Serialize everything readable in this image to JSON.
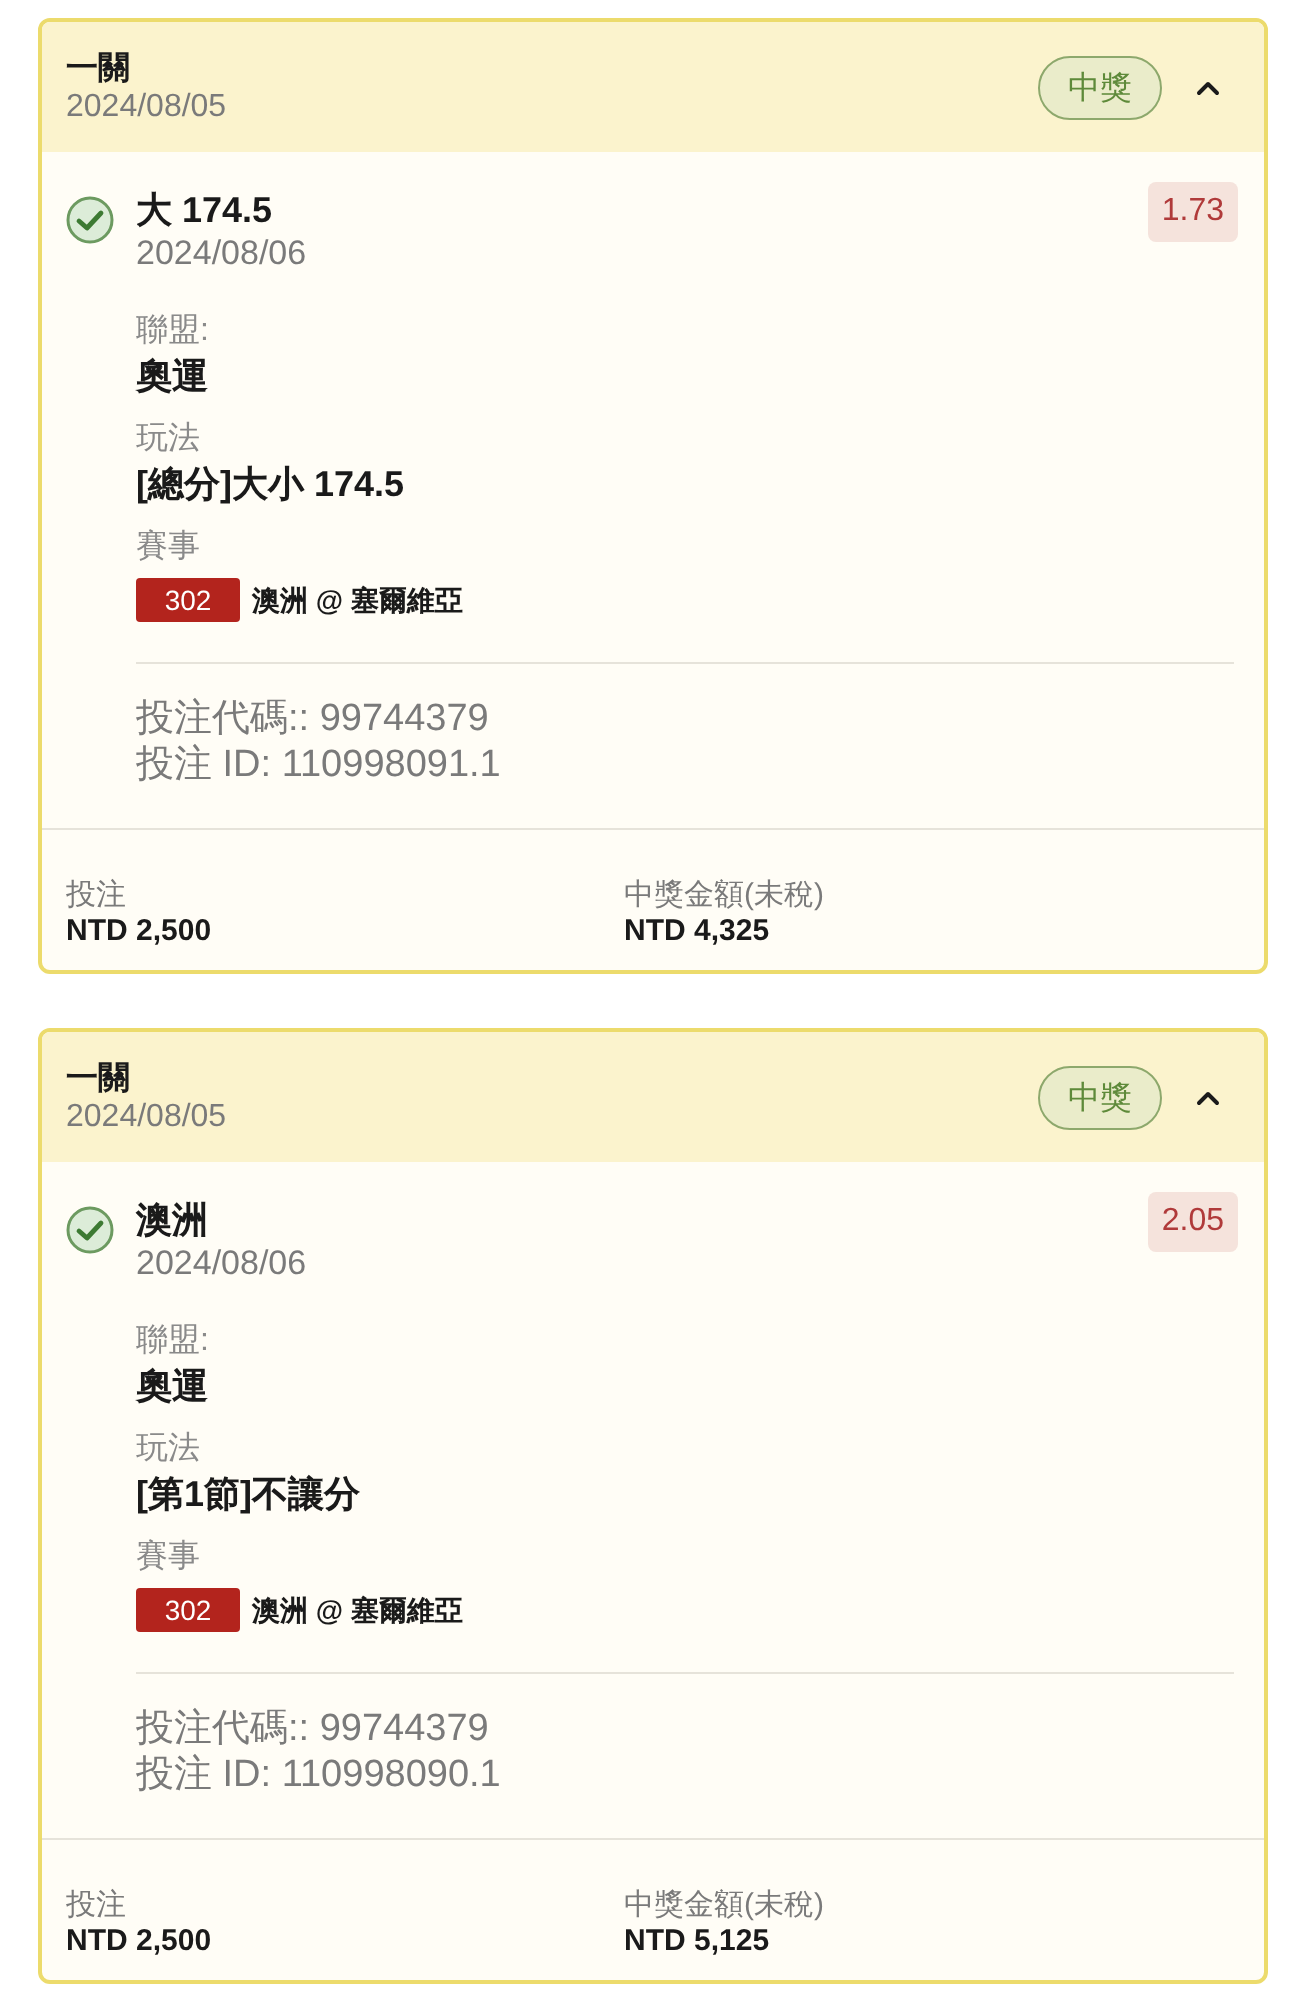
{
  "bets": [
    {
      "type": "一關",
      "date": "2024/08/05",
      "status": "中獎",
      "expanded": true,
      "legs": [
        {
          "won": true,
          "selection": "大 174.5",
          "date": "2024/08/06",
          "odds": "1.73",
          "fields": [
            {
              "label": "聯盟:",
              "value": "奧運"
            },
            {
              "label": "玩法",
              "value": "[總分]大小 174.5"
            }
          ],
          "event": {
            "label": "賽事",
            "code": "302",
            "teams": "澳洲 @ 塞爾維亞"
          },
          "bet_code": "投注代碼:: 99744379",
          "bet_id": "投注 ID: 110998091.1"
        }
      ],
      "summary": [
        {
          "label": "投注",
          "value": "NTD 2,500"
        },
        {
          "label": "中獎金額(未稅)",
          "value": "NTD 4,325"
        }
      ]
    },
    {
      "type": "一關",
      "date": "2024/08/05",
      "status": "中獎",
      "expanded": true,
      "legs": [
        {
          "won": true,
          "selection": "澳洲",
          "date": "2024/08/06",
          "odds": "2.05",
          "fields": [
            {
              "label": "聯盟:",
              "value": "奧運"
            },
            {
              "label": "玩法",
              "value": "[第1節]不讓分"
            }
          ],
          "event": {
            "label": "賽事",
            "code": "302",
            "teams": "澳洲 @ 塞爾維亞"
          },
          "bet_code": "投注代碼:: 99744379",
          "bet_id": "投注 ID: 110998090.1"
        }
      ],
      "summary": [
        {
          "label": "投注",
          "value": "NTD 2,500"
        },
        {
          "label": "中獎金額(未稅)",
          "value": "NTD 5,125"
        }
      ]
    }
  ]
}
